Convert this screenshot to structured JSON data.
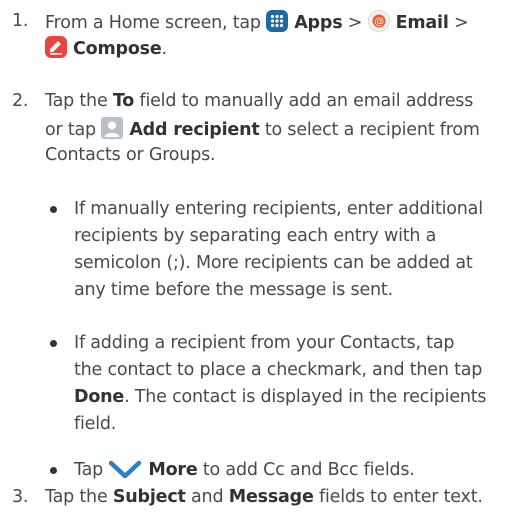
{
  "steps": {
    "s1": {
      "num": "1.",
      "text1": "From a Home screen, tap ",
      "apps": "Apps",
      "sep1": " > ",
      "email": "Email",
      "sep2": " >",
      "compose": "Compose",
      "end": "."
    },
    "s2": {
      "num": "2.",
      "tap": "Tap the ",
      "to": "To",
      "l1rest": " field to manually add an email address",
      "l2a": "or tap ",
      "add_recipient": "Add recipient",
      "l2b": " to select a recipient from",
      "l3": "Contacts or Groups."
    },
    "bullet1": [
      "If manually entering recipients, enter additional",
      "recipients by separating each entry with a",
      "semicolon (;). More recipients can be added at",
      "any time before the message is sent."
    ],
    "bullet2": {
      "l1": "If adding a recipient from your Contacts, tap",
      "l2": "the contact to place a checkmark, and then tap",
      "done": "Done",
      "l3rest": ". The contact is displayed in the recipients",
      "l4": "field."
    },
    "bullet3": {
      "tap": "Tap ",
      "more": "More",
      "rest": " to add Cc and Bcc fields."
    },
    "s3": {
      "num": "3.",
      "tap": "Tap the ",
      "subject": "Subject",
      "and": " and ",
      "message": "Message",
      "rest": " fields to enter text."
    }
  },
  "icons": {
    "apps": "apps-grid-icon",
    "email": "email-app-icon",
    "compose": "compose-icon",
    "add_recipient": "contact-icon",
    "more": "chevron-down-icon"
  },
  "colors": {
    "apps_icon": "#1e6aa0",
    "compose_icon": "#e8453c",
    "contact_icon": "#b9c0c7",
    "chevron": "#2a7fc5"
  }
}
